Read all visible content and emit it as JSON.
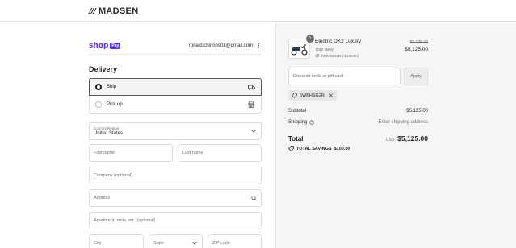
{
  "header": {
    "logo_mark": "///",
    "logo_text": "MADSEN"
  },
  "account": {
    "shop_word": "shop",
    "shop_pay": "Pay",
    "email": "ronald.chirinos03@gmail.com",
    "menu_glyph": "⋮"
  },
  "delivery": {
    "title": "Delivery",
    "options": [
      {
        "label": "Ship",
        "selected": true,
        "icon": "truck-icon"
      },
      {
        "label": "Pick up",
        "selected": false,
        "icon": "store-icon"
      }
    ]
  },
  "form": {
    "country_label": "Country/Region",
    "country_value": "United States",
    "first_name_placeholder": "First name",
    "last_name_placeholder": "Last name",
    "company_placeholder": "Company (optional)",
    "address_placeholder": "Address",
    "apartment_placeholder": "Apartment, suite, etc. (optional)",
    "city_placeholder": "City",
    "state_placeholder": "State",
    "zip_placeholder": "ZIP code"
  },
  "cart": {
    "quantity": "1",
    "product_name": "Electric DK2 Luxury",
    "variant": "True Navy",
    "discount_line": "5WBHSG2R (-$100.00)",
    "price_original": "$5,225.00",
    "price_final": "$5,125.00"
  },
  "discount": {
    "placeholder": "Discount code or gift card",
    "apply_label": "Apply",
    "applied_code": "5WBHSG2R",
    "remove_glyph": "✕"
  },
  "summary": {
    "subtotal_label": "Subtotal",
    "subtotal_value": "$5,125.00",
    "shipping_label": "Shipping",
    "shipping_value": "Enter shipping address",
    "total_label": "Total",
    "currency": "USD",
    "total_value": "$5,125.00",
    "savings_label": "TOTAL SAVINGS",
    "savings_value": "$100.00"
  },
  "colors": {
    "shop_brand": "#5a31f4",
    "panel_bg": "#f5f5f5",
    "border": "#dcdcdc"
  }
}
